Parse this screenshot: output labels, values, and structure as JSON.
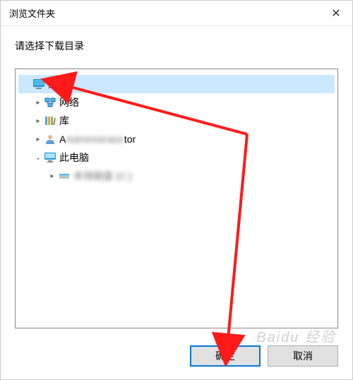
{
  "dialog": {
    "title": "浏览文件夹",
    "instruction": "请选择下载目录"
  },
  "tree": {
    "root": {
      "label": "桌面",
      "icon": "desktop"
    },
    "items": [
      {
        "label": "网络",
        "icon": "network",
        "expander": "▸"
      },
      {
        "label": "库",
        "icon": "library",
        "expander": "▸"
      },
      {
        "label": "Administrator",
        "icon": "user",
        "expander": "▸"
      },
      {
        "label": "此电脑",
        "icon": "pc",
        "expander": "⌄"
      }
    ],
    "drive": {
      "label": "本地磁盘 (C:)",
      "icon": "drive",
      "expander": "▸"
    }
  },
  "buttons": {
    "ok": "确定",
    "cancel": "取消"
  },
  "watermark": "Baidu 经验",
  "colors": {
    "arrow": "#ff1a1a",
    "focus": "#0078d7"
  }
}
